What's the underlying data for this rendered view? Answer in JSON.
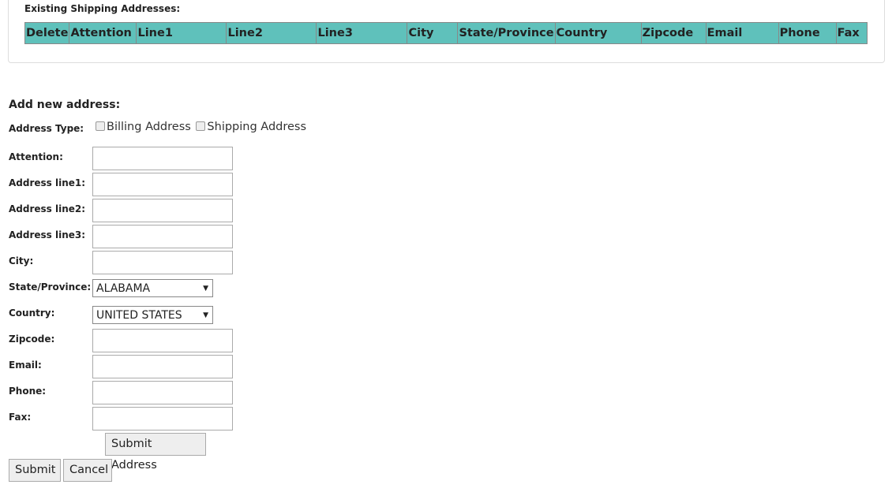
{
  "existing": {
    "title": "Existing Shipping Addresses:",
    "columns": [
      "Delete",
      "Attention",
      "Line1",
      "Line2",
      "Line3",
      "City",
      "State/Province",
      "Country",
      "Zipcode",
      "Email",
      "Phone",
      "Fax"
    ]
  },
  "form": {
    "title": "Add new address:",
    "address_type_label": "Address Type:",
    "billing": "Billing Address",
    "shipping": "Shipping Address",
    "fields": {
      "attention": "Attention:",
      "line1": "Address line1:",
      "line2": "Address line2:",
      "line3": "Address line3:",
      "city": "City:",
      "state": "State/Province:",
      "country": "Country:",
      "zipcode": "Zipcode:",
      "email": "Email:",
      "phone": "Phone:",
      "fax": "Fax:"
    },
    "state_value": "ALABAMA",
    "country_value": "UNITED STATES",
    "submit_address": "Submit Address"
  },
  "actions": {
    "submit": "Submit",
    "cancel": "Cancel"
  }
}
